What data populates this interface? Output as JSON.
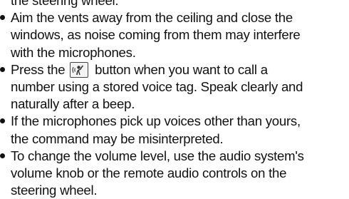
{
  "top_partial_line": "the steering wheel.",
  "bullets": [
    {
      "lines": [
        "Aim the vents away from the ceiling and close the",
        "windows, as noise coming from them may interfere",
        "with the microphones."
      ]
    },
    {
      "line1_before_icon": "Press the",
      "icon": "talk-button-icon",
      "line1_after_icon": "button when you want to call a",
      "lines_rest": [
        "number using a stored voice tag. Speak clearly and",
        "naturally after a beep."
      ]
    },
    {
      "lines": [
        "If the microphones pick up voices other than yours,",
        "the command may be misinterpreted."
      ]
    },
    {
      "lines": [
        "To change the volume level, use the audio system's",
        "volume knob or the remote audio controls on the",
        "steering wheel."
      ]
    }
  ]
}
